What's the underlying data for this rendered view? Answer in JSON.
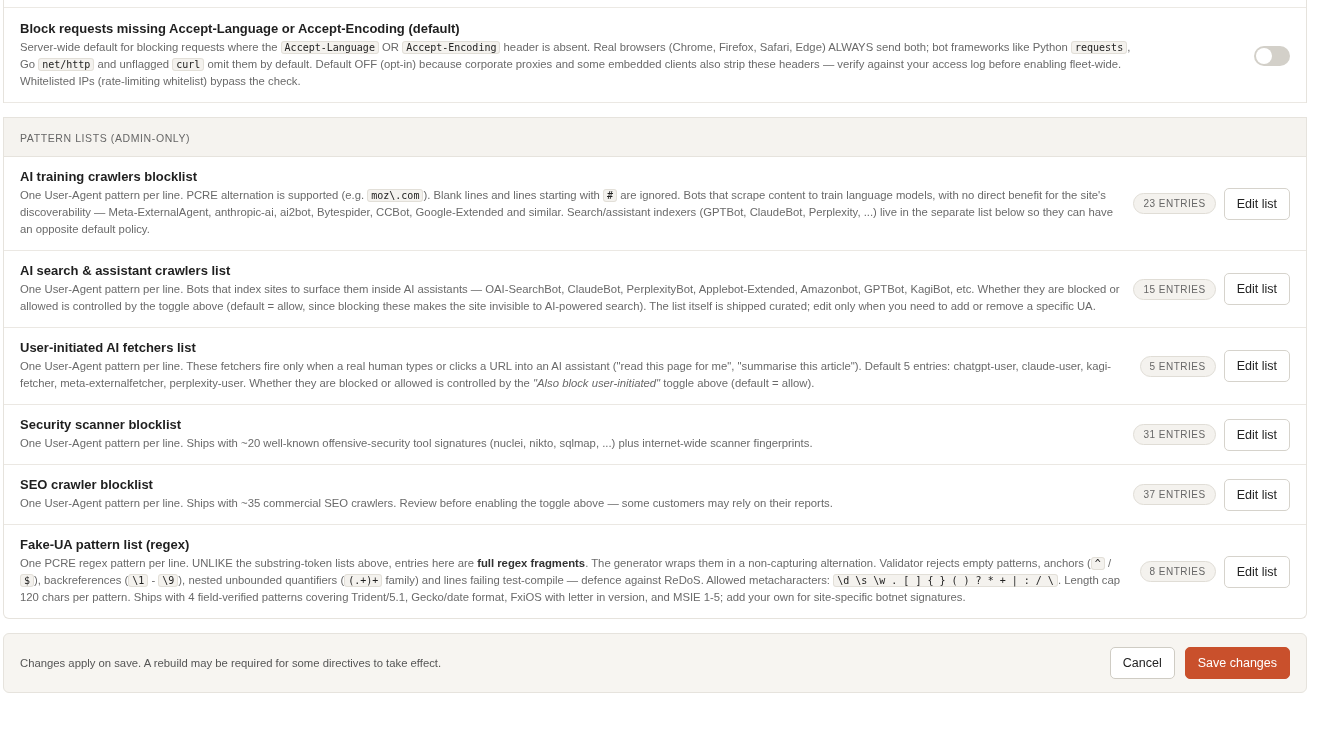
{
  "toggle_setting": {
    "title": "Block requests missing Accept-Language or Accept-Encoding (default)",
    "on": false,
    "description": [
      {
        "kind": "text",
        "text": "Server-wide default for blocking requests where the "
      },
      {
        "kind": "code",
        "text": "Accept-Language"
      },
      {
        "kind": "text",
        "text": " OR "
      },
      {
        "kind": "code",
        "text": "Accept-Encoding"
      },
      {
        "kind": "text",
        "text": " header is absent. Real browsers (Chrome, Firefox, Safari, Edge) ALWAYS send both; bot frameworks like Python "
      },
      {
        "kind": "code",
        "text": "requests"
      },
      {
        "kind": "text",
        "text": ", Go "
      },
      {
        "kind": "code",
        "text": "net/http"
      },
      {
        "kind": "text",
        "text": " and unflagged "
      },
      {
        "kind": "code",
        "text": "curl"
      },
      {
        "kind": "text",
        "text": " omit them by default. Default OFF (opt-in) because corporate proxies and some embedded clients also strip these headers — verify against your access log before enabling fleet-wide. Whitelisted IPs (rate-limiting whitelist) bypass the check."
      }
    ]
  },
  "section": {
    "heading": "PATTERN LISTS (ADMIN-ONLY)",
    "lists": [
      {
        "title": "AI training crawlers blocklist",
        "entries": "23 ENTRIES",
        "button": "Edit list",
        "description": [
          {
            "kind": "text",
            "text": "One User-Agent pattern per line. PCRE alternation is supported (e.g. "
          },
          {
            "kind": "code",
            "text": "moz\\.com"
          },
          {
            "kind": "text",
            "text": "). Blank lines and lines starting with "
          },
          {
            "kind": "code",
            "text": "#"
          },
          {
            "kind": "text",
            "text": " are ignored. Bots that scrape content to train language models, with no direct benefit for the site's discoverability — Meta-ExternalAgent, anthropic-ai, ai2bot, Bytespider, CCBot, Google-Extended and similar. Search/assistant indexers (GPTBot, ClaudeBot, Perplexity, ...) live in the separate list below so they can have an opposite default policy."
          }
        ]
      },
      {
        "title": "AI search & assistant crawlers list",
        "entries": "15 ENTRIES",
        "button": "Edit list",
        "description": [
          {
            "kind": "text",
            "text": "One User-Agent pattern per line. Bots that index sites to surface them inside AI assistants — OAI-SearchBot, ClaudeBot, PerplexityBot, Applebot-Extended, Amazonbot, GPTBot, KagiBot, etc. Whether they are blocked or allowed is controlled by the toggle above (default = allow, since blocking these makes the site invisible to AI-powered search). The list itself is shipped curated; edit only when you need to add or remove a specific UA."
          }
        ]
      },
      {
        "title": "User-initiated AI fetchers list",
        "entries": "5 ENTRIES",
        "button": "Edit list",
        "description": [
          {
            "kind": "text",
            "text": "One User-Agent pattern per line. These fetchers fire only when a real human types or clicks a URL into an AI assistant (\"read this page for me\", \"summarise this article\"). Default 5 entries: chatgpt-user, claude-user, kagi-fetcher, meta-externalfetcher, perplexity-user. Whether they are blocked or allowed is controlled by the "
          },
          {
            "kind": "italic",
            "text": "\"Also block user-initiated\""
          },
          {
            "kind": "text",
            "text": " toggle above (default = allow)."
          }
        ]
      },
      {
        "title": "Security scanner blocklist",
        "entries": "31 ENTRIES",
        "button": "Edit list",
        "description": [
          {
            "kind": "text",
            "text": "One User-Agent pattern per line. Ships with ~20 well-known offensive-security tool signatures (nuclei, nikto, sqlmap, ...) plus internet-wide scanner fingerprints."
          }
        ]
      },
      {
        "title": "SEO crawler blocklist",
        "entries": "37 ENTRIES",
        "button": "Edit list",
        "description": [
          {
            "kind": "text",
            "text": "One User-Agent pattern per line. Ships with ~35 commercial SEO crawlers. Review before enabling the toggle above — some customers may rely on their reports."
          }
        ]
      },
      {
        "title": "Fake-UA pattern list (regex)",
        "entries": "8 ENTRIES",
        "button": "Edit list",
        "description": [
          {
            "kind": "text",
            "text": "One PCRE regex pattern per line. UNLIKE the substring-token lists above, entries here are "
          },
          {
            "kind": "bold",
            "text": "full regex fragments"
          },
          {
            "kind": "text",
            "text": ". The generator wraps them in a non-capturing alternation. Validator rejects empty patterns, anchors ("
          },
          {
            "kind": "code",
            "text": "^"
          },
          {
            "kind": "text",
            "text": " / "
          },
          {
            "kind": "code",
            "text": "$"
          },
          {
            "kind": "text",
            "text": "), backreferences ("
          },
          {
            "kind": "code",
            "text": "\\1"
          },
          {
            "kind": "text",
            "text": " - "
          },
          {
            "kind": "code",
            "text": "\\9"
          },
          {
            "kind": "text",
            "text": "), nested unbounded quantifiers ("
          },
          {
            "kind": "code",
            "text": "(.+)+"
          },
          {
            "kind": "text",
            "text": " family) and lines failing test-compile — defence against ReDoS. Allowed metacharacters: "
          },
          {
            "kind": "code",
            "text": "\\d \\s \\w . [ ] { } ( ) ? * + | : / \\"
          },
          {
            "kind": "text",
            "text": ". Length cap 120 chars per pattern. Ships with 4 field-verified patterns covering Trident/5.1, Gecko/date format, FxiOS with letter in version, and MSIE 1-5; add your own for site-specific botnet signatures."
          }
        ]
      }
    ]
  },
  "footer": {
    "note": "Changes apply on save. A rebuild may be required for some directives to take effect.",
    "buttons": [
      {
        "label": "Cancel",
        "kind": "secondary"
      },
      {
        "label": "Save changes",
        "kind": "primary"
      }
    ]
  }
}
